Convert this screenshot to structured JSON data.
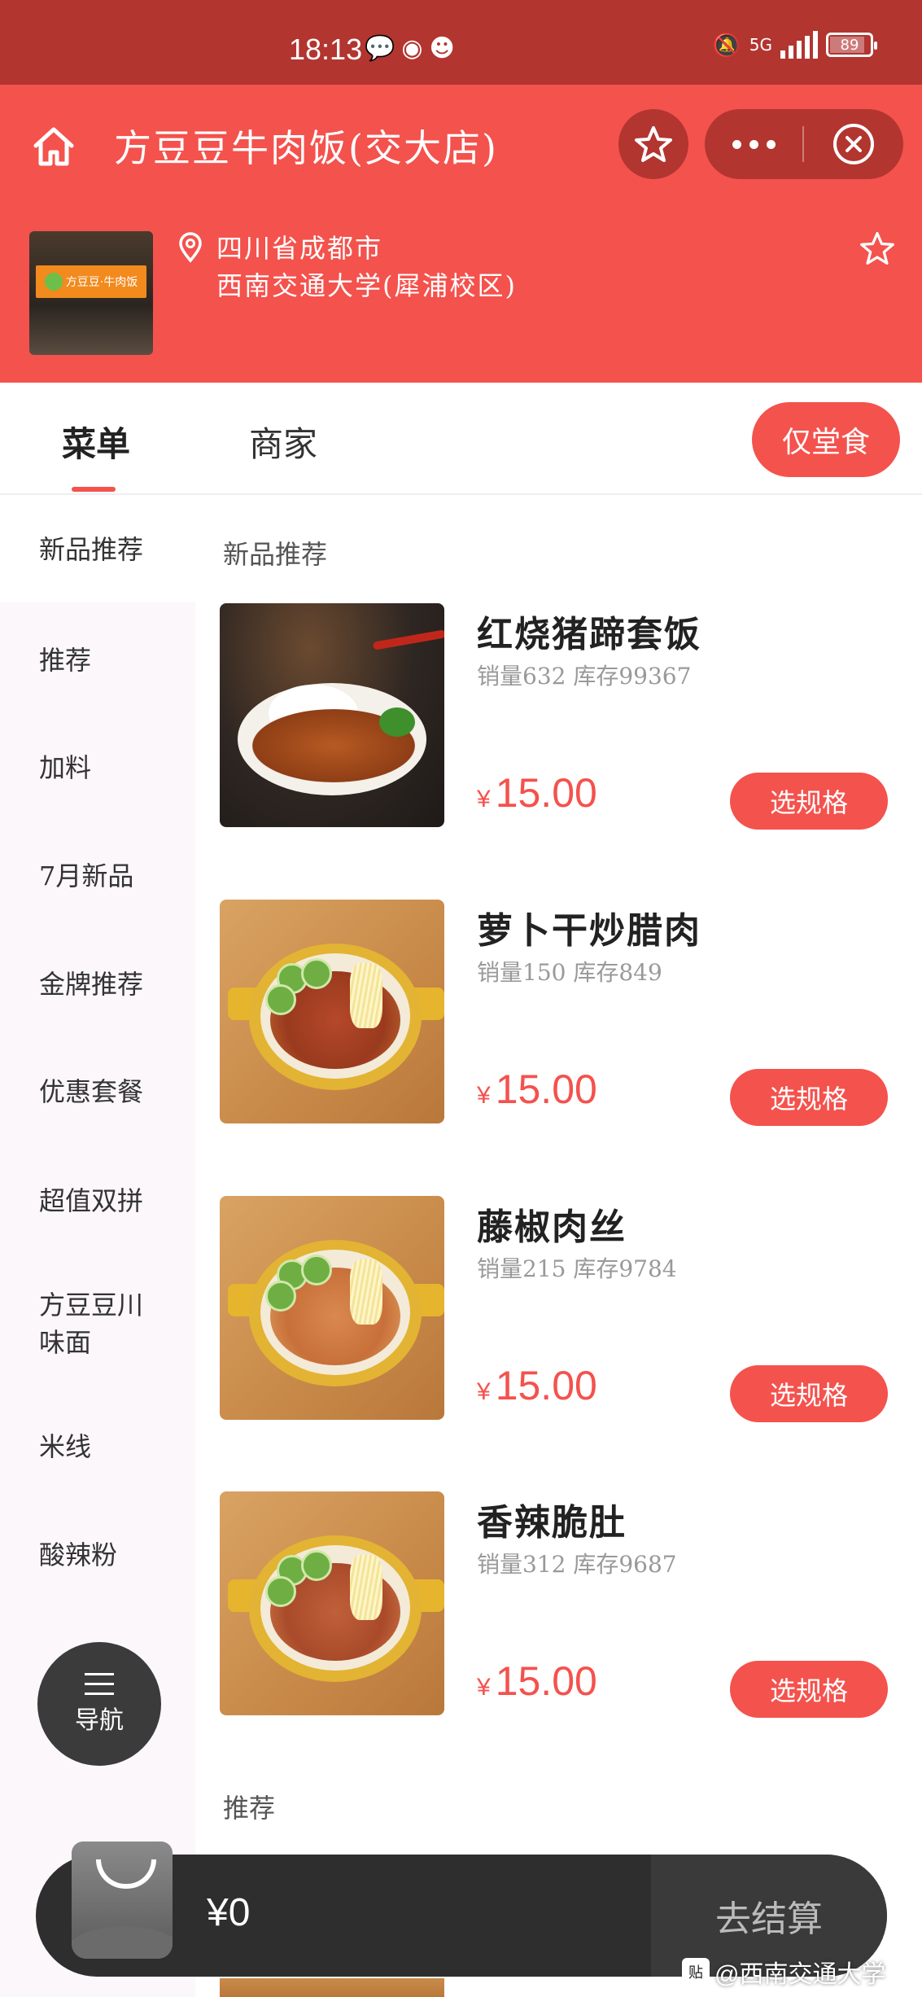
{
  "status_bar": {
    "time": "18:13",
    "network": "5G",
    "battery": "89"
  },
  "header": {
    "title": "方豆豆牛肉饭(交大店)",
    "address_line1": "四川省成都市",
    "address_line2": "西南交通大学(犀浦校区)"
  },
  "tabs": {
    "menu": "菜单",
    "merchant": "商家",
    "dine_in": "仅堂食"
  },
  "sidebar": {
    "items": [
      {
        "label": "新品推荐"
      },
      {
        "label": "推荐"
      },
      {
        "label": "加料"
      },
      {
        "label": "7月新品"
      },
      {
        "label": "金牌推荐"
      },
      {
        "label": "优惠套餐"
      },
      {
        "label": "超值双拼"
      },
      {
        "label": "方豆豆川味面"
      },
      {
        "label": "米线"
      },
      {
        "label": "酸辣粉"
      }
    ],
    "nav_label": "导航"
  },
  "sections": [
    {
      "title": "新品推荐",
      "items": [
        {
          "name": "红烧猪蹄套饭",
          "stats": "销量632 库存99367",
          "currency": "¥",
          "price": "15.00",
          "button": "选规格"
        },
        {
          "name": "萝卜干炒腊肉",
          "stats": "销量150 库存849",
          "currency": "¥",
          "price": "15.00",
          "button": "选规格"
        },
        {
          "name": "藤椒肉丝",
          "stats": "销量215 库存9784",
          "currency": "¥",
          "price": "15.00",
          "button": "选规格"
        },
        {
          "name": "香辣脆肚",
          "stats": "销量312 库存9687",
          "currency": "¥",
          "price": "15.00",
          "button": "选规格"
        }
      ]
    },
    {
      "title": "推荐"
    }
  ],
  "cart": {
    "total": "¥0",
    "checkout": "去结算"
  },
  "watermark": {
    "logo": "贴",
    "text": "@西南交通大学"
  },
  "colors": {
    "primary": "#f4524d",
    "status_bar": "#b23530",
    "cart_bar": "#2e2e2e"
  }
}
